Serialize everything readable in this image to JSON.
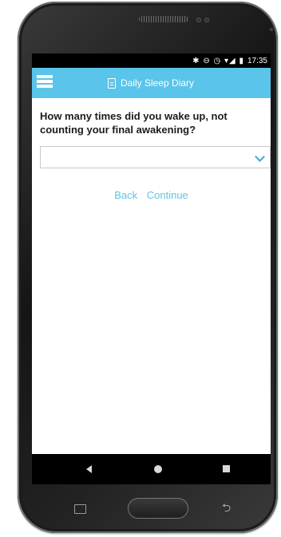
{
  "status_bar": {
    "icons": "✱ ⊖ ◷ ▾◢ ▮",
    "time": "17:35"
  },
  "app_bar": {
    "title": "Daily Sleep Diary"
  },
  "question": {
    "text": "How many times did you wake up, not counting your final awakening?"
  },
  "select": {
    "value": ""
  },
  "actions": {
    "back_label": "Back",
    "continue_label": "Continue"
  },
  "colors": {
    "accent": "#5bc4ea",
    "status_bar": "#000000",
    "text": "#1c1c1c"
  }
}
